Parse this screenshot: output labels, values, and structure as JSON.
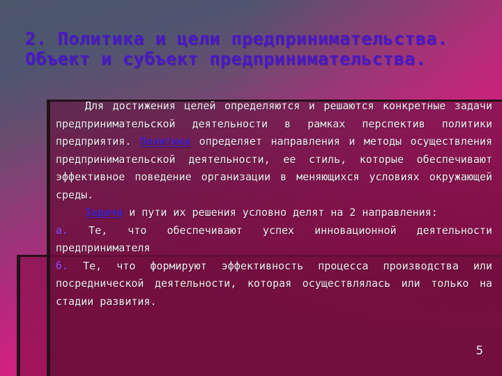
{
  "slide": {
    "title": "2. Политика и цели предпринимательства. Объект и субъект предпринимательства.",
    "page_number": "5",
    "colors": {
      "title": "#4a18c8",
      "link": "#4422c8",
      "marker": "#8a3fd0",
      "body_text": "#f2eef2",
      "panel_front": "#6f0f3d",
      "panel_back": "#840e47",
      "panel_border": "#241018",
      "background_top": "#4b556c",
      "background_bottom": "#f4157f"
    },
    "paragraphs": [
      {
        "id": "p1",
        "indent": true,
        "runs": [
          {
            "type": "text",
            "text": "Для достижения целей определяются и решаются конкретные задачи предпринимательской деятельности в рамках перспектив политики предприятия. "
          },
          {
            "type": "link",
            "text": "Политика"
          },
          {
            "type": "text",
            "text": " определяет направления и методы осуществления предпринимательской деятельности, ее стиль, которые обеспечивают эффективное поведение организации в меняющихся условиях окружающей среды."
          }
        ]
      },
      {
        "id": "p2",
        "indent": true,
        "runs": [
          {
            "type": "link",
            "text": "Задачи"
          },
          {
            "type": "text",
            "text": " и пути их решения условно делят на 2 направления:"
          }
        ]
      },
      {
        "id": "p3",
        "indent": false,
        "runs": [
          {
            "type": "marker",
            "text": "а."
          },
          {
            "type": "text",
            "text": " Те, что обеспечивают успех инновационной деятельности предпринимателя"
          }
        ]
      },
      {
        "id": "p4",
        "indent": false,
        "runs": [
          {
            "type": "marker",
            "text": "б."
          },
          {
            "type": "text",
            "text": " Те, что формируют эффективность процесса производства или посреднической деятельности, которая осуществлялась или только на стадии развития."
          }
        ]
      }
    ]
  }
}
